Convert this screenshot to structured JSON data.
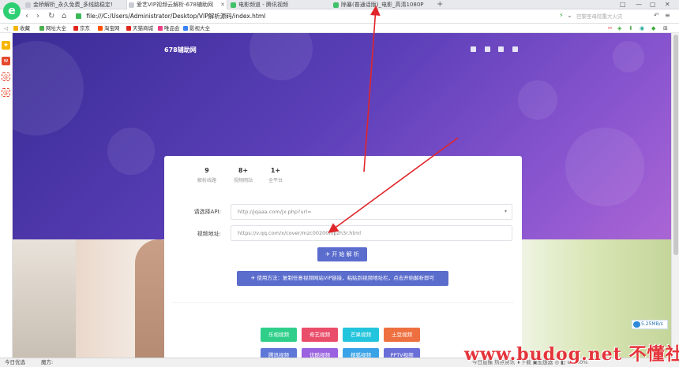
{
  "browser": {
    "tabs": [
      {
        "label": "金桥解析_永久免费_多线路稳定!",
        "active": false
      },
      {
        "label": "爱艺VIP视频云解析-678辅助网",
        "active": true
      },
      {
        "label": "电影频道 - 腾讯视频",
        "active": false
      },
      {
        "label": "除暴(普通话版)_电影_高清1080P",
        "active": false
      }
    ],
    "url": "file:///C:/Users/Administrator/Desktop/VIP解析源码/index.html",
    "search_placeholder": "巴黎圣母院重大火灾",
    "window_controls": [
      "□",
      "—",
      "▢",
      "✕"
    ]
  },
  "bookmarks": [
    {
      "label": "收藏",
      "color": "#f5b400"
    },
    {
      "label": "网址大全",
      "color": "#4caf50"
    },
    {
      "label": "京东",
      "color": "#e1251b"
    },
    {
      "label": "淘宝网",
      "color": "#ff5000"
    },
    {
      "label": "天猫商城",
      "color": "#e1251b"
    },
    {
      "label": "唯品会",
      "color": "#f03e82"
    },
    {
      "label": "影视大全",
      "color": "#3b82f6"
    }
  ],
  "page": {
    "site_title": "678辅助网",
    "stats": [
      {
        "value": "9",
        "label": "解析线路"
      },
      {
        "value": "8+",
        "label": "视频网站"
      },
      {
        "value": "1+",
        "label": "全平台"
      }
    ],
    "api_label": "请选择API:",
    "api_value": "http://jqaaa.com/jx.php?url=",
    "video_label": "视频地址:",
    "video_value": "https://v.qq.com/x/cover/mzc00200hlpzh3r.html",
    "parse_button": "✈ 开 始 解 析",
    "tip_button": "✈ 使用方法：复制任意视频网站VIP链接，粘贴到视频地址栏，点击开始解析即可",
    "video_sites": [
      {
        "label": "乐视视频",
        "color": "#2fcf8a"
      },
      {
        "label": "奇艺视频",
        "color": "#ea4d6a"
      },
      {
        "label": "芒果视频",
        "color": "#23c5dc"
      },
      {
        "label": "土豆视频",
        "color": "#ee7040"
      },
      {
        "label": "腾讯视频",
        "color": "#5f78d8"
      },
      {
        "label": "优酷视频",
        "color": "#9a62e0"
      },
      {
        "label": "搜狐视频",
        "color": "#3aa3e8"
      },
      {
        "label": "PPTV视频",
        "color": "#6a6fd8"
      }
    ]
  },
  "statusbar": {
    "left": "今日优选",
    "left2": "魔方:",
    "right": "今日直播  热点资讯  ⬇下载  ▣加速器  ◎  ◧  ⊕  100%",
    "speed": "5.25MB/s"
  },
  "watermark": "www.budog.net 不懂社区"
}
